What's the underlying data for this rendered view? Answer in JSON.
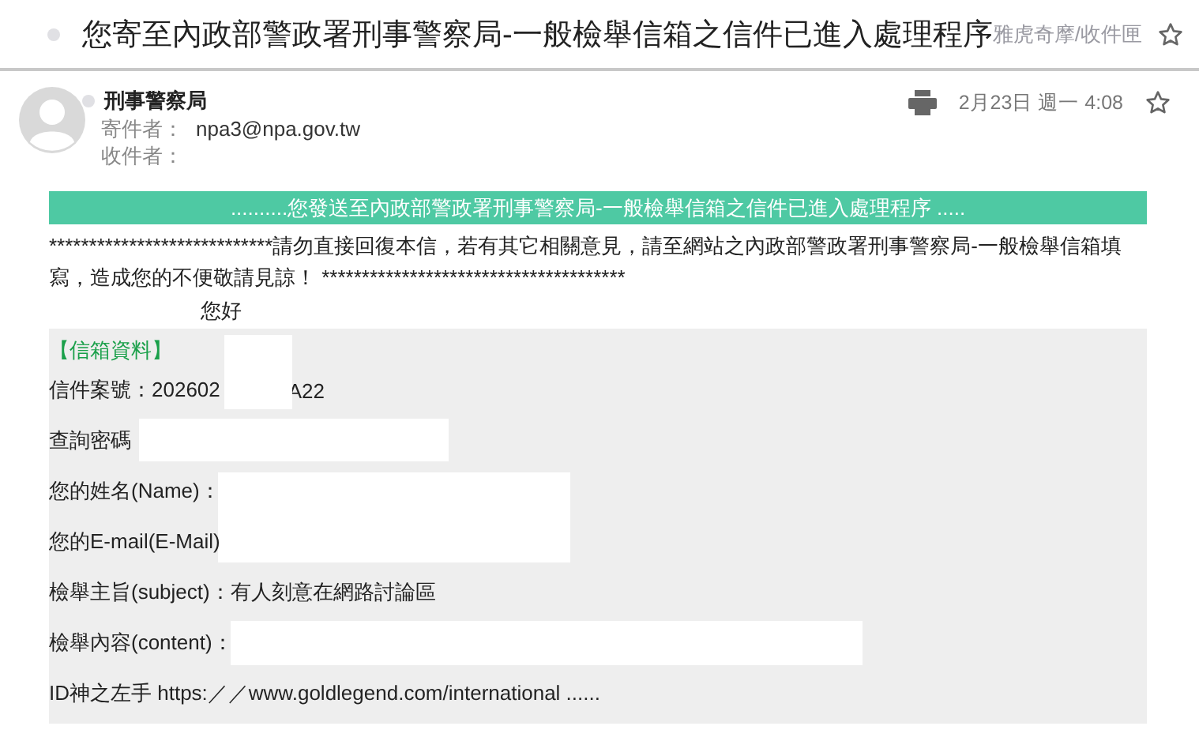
{
  "subject": "您寄至內政部警政署刑事警察局-一般檢舉信箱之信件已進入處理程序",
  "folder": "雅虎奇摩/收件匣",
  "starred": false,
  "sender": {
    "name": "刑事警察局",
    "from_label": "寄件者：",
    "from": "npa3@npa.gov.tw",
    "to_label": "收件者："
  },
  "date": "2月23日 週一 4:08",
  "banner": "..........您發送至內政部警政署刑事警察局-一般檢舉信箱之信件已進入處理程序 .....",
  "notice": "****************************請勿直接回復本信，若有其它相關意見，請至網站之內政部警政署刑事警察局-一般檢舉信箱填寫，造成您的不便敬請見諒！ **************************************",
  "greeting": "您好",
  "section_title": "【信箱資料】",
  "fields": [
    {
      "text": "信件案號：202602",
      "suffix": "A22"
    },
    {
      "text": "查詢密碼"
    },
    {
      "text": "您的姓名(Name)："
    },
    {
      "text": "您的E-mail(E-Mail)"
    },
    {
      "text": "檢舉主旨(subject)：有人刻意在網路討論區"
    },
    {
      "text": "檢舉內容(content)："
    },
    {
      "text": "ID神之左手 https:／／www.goldlegend.com/international ......"
    }
  ]
}
